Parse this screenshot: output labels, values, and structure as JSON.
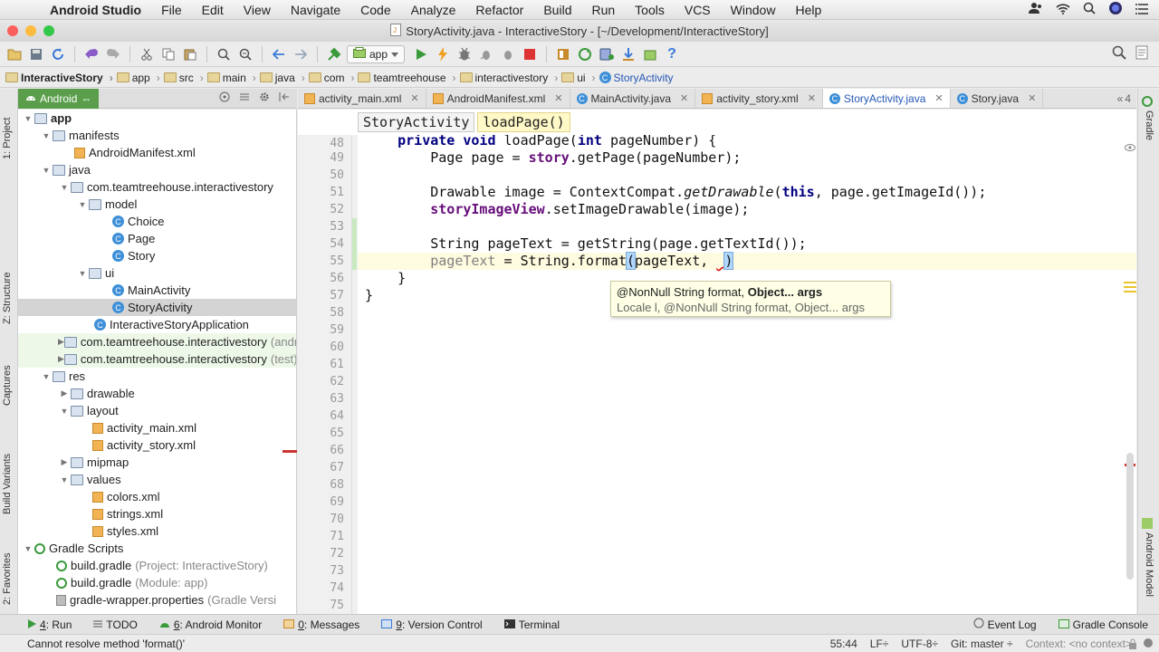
{
  "menubar": {
    "app_name": "Android Studio",
    "items": [
      "File",
      "Edit",
      "View",
      "Navigate",
      "Code",
      "Analyze",
      "Refactor",
      "Build",
      "Run",
      "Tools",
      "VCS",
      "Window",
      "Help"
    ]
  },
  "window": {
    "title": "StoryActivity.java - InteractiveStory - [~/Development/InteractiveStory]"
  },
  "toolbar": {
    "run_config": "app"
  },
  "navbar": {
    "crumbs": [
      "InteractiveStory",
      "app",
      "src",
      "main",
      "java",
      "com",
      "teamtreehouse",
      "interactivestory",
      "ui",
      "StoryActivity"
    ]
  },
  "side_strips": {
    "left": [
      "1: Project",
      "Z: Structure",
      "Captures",
      "Build Variants",
      "2: Favorites"
    ],
    "right": [
      "Gradle",
      "Android Model"
    ]
  },
  "project_panel": {
    "view_mode": "Android",
    "tree": [
      {
        "label": "app",
        "icon": "folder",
        "bold": true
      },
      {
        "label": "manifests",
        "icon": "folder"
      },
      {
        "label": "AndroidManifest.xml",
        "icon": "xml"
      },
      {
        "label": "java",
        "icon": "folder"
      },
      {
        "label": "com.teamtreehouse.interactivestory",
        "icon": "package"
      },
      {
        "label": "model",
        "icon": "package"
      },
      {
        "label": "Choice",
        "icon": "class"
      },
      {
        "label": "Page",
        "icon": "class"
      },
      {
        "label": "Story",
        "icon": "class"
      },
      {
        "label": "ui",
        "icon": "package"
      },
      {
        "label": "MainActivity",
        "icon": "class"
      },
      {
        "label": "StoryActivity",
        "icon": "class",
        "selected": true
      },
      {
        "label": "InteractiveStoryApplication",
        "icon": "class"
      },
      {
        "label": "com.teamtreehouse.interactivestory",
        "icon": "package",
        "suffix": " (androidTest)"
      },
      {
        "label": "com.teamtreehouse.interactivestory",
        "icon": "package",
        "suffix": " (test)"
      },
      {
        "label": "res",
        "icon": "folder"
      },
      {
        "label": "drawable",
        "icon": "folder"
      },
      {
        "label": "layout",
        "icon": "folder"
      },
      {
        "label": "activity_main.xml",
        "icon": "xml"
      },
      {
        "label": "activity_story.xml",
        "icon": "xml"
      },
      {
        "label": "mipmap",
        "icon": "folder"
      },
      {
        "label": "values",
        "icon": "folder"
      },
      {
        "label": "colors.xml",
        "icon": "xml"
      },
      {
        "label": "strings.xml",
        "icon": "xml"
      },
      {
        "label": "styles.xml",
        "icon": "xml"
      },
      {
        "label": "Gradle Scripts",
        "icon": "gradle"
      },
      {
        "label": "build.gradle",
        "icon": "gradle",
        "note": "(Project: InteractiveStory)"
      },
      {
        "label": "build.gradle",
        "icon": "gradle",
        "note": "(Module: app)"
      },
      {
        "label": "gradle-wrapper.properties",
        "icon": "props",
        "note": "(Gradle Versi"
      }
    ]
  },
  "editor": {
    "tabs": [
      {
        "label": "activity_main.xml",
        "type": "xml"
      },
      {
        "label": "AndroidManifest.xml",
        "type": "xml"
      },
      {
        "label": "MainActivity.java",
        "type": "class"
      },
      {
        "label": "activity_story.xml",
        "type": "xml"
      },
      {
        "label": "StoryActivity.java",
        "type": "class",
        "active": true
      },
      {
        "label": "Story.java",
        "type": "class"
      }
    ],
    "tabs_overflow": "4",
    "breadcrumb_class": "StoryActivity",
    "breadcrumb_method": "loadPage()",
    "line_numbers": [
      "48",
      "49",
      "50",
      "51",
      "52",
      "53",
      "54",
      "55",
      "56",
      "57",
      "58",
      "59",
      "60",
      "61",
      "62",
      "63",
      "64",
      "65",
      "66",
      "67",
      "68",
      "69",
      "70",
      "71",
      "72",
      "73",
      "74",
      "75"
    ],
    "code": {
      "l48": "    private void loadPage(int pageNumber) {",
      "l49": "        Page page = story.getPage(pageNumber);",
      "l51": "        Drawable image = ContextCompat.getDrawable(this, page.getImageId());",
      "l52": "        storyImageView.setImageDrawable(image);",
      "l54": "        String pageText = getString(page.getTextId());",
      "l55": "        pageText = String.format(pageText, )",
      "l56": "    }",
      "l57": "}"
    },
    "param_hint": {
      "line1_prefix": "@NonNull String format, ",
      "line1_bold": "Object... args",
      "line2": "Locale l, @NonNull String format, Object... args"
    }
  },
  "bottom_tools": [
    {
      "num": "4",
      "label": ": Run",
      "color": "#3a9a3a"
    },
    {
      "num": "",
      "label": "TODO",
      "color": "#555555"
    },
    {
      "num": "6",
      "label": ": Android Monitor",
      "color": "#3a9a3a"
    },
    {
      "num": "0",
      "label": ": Messages",
      "color": "#c98a2a"
    },
    {
      "num": "9",
      "label": ": Version Control",
      "color": "#3b7bd8"
    },
    {
      "num": "",
      "label": "Terminal",
      "color": "#333333"
    }
  ],
  "bottom_right_tools": [
    "Event Log",
    "Gradle Console"
  ],
  "statusbar": {
    "message": "Cannot resolve method 'format()'",
    "position": "55:44",
    "line_sep": "LF÷",
    "encoding": "UTF-8÷",
    "vcs": "Git: master ÷",
    "context": "Context: <no context>"
  },
  "colors": {
    "keyword": "#000080",
    "field": "#660e7a",
    "error": "#dd0000",
    "android_green": "#5a9e4b",
    "link_blue": "#2557b6"
  }
}
